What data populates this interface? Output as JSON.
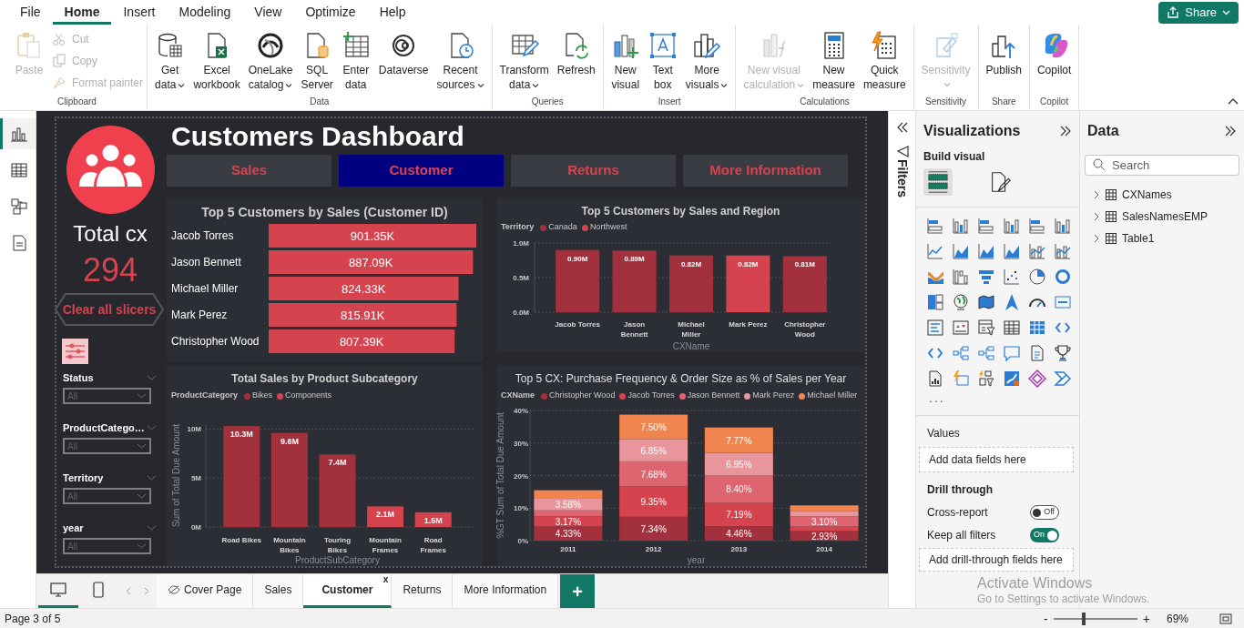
{
  "menu": [
    {
      "label": "File",
      "selected": false
    },
    {
      "label": "Home",
      "selected": true
    },
    {
      "label": "Insert",
      "selected": false
    },
    {
      "label": "Modeling",
      "selected": false
    },
    {
      "label": "View",
      "selected": false
    },
    {
      "label": "Optimize",
      "selected": false
    },
    {
      "label": "Help",
      "selected": false
    }
  ],
  "share_button": {
    "label": "Share"
  },
  "ribbon_groups": [
    {
      "label": "Clipboard",
      "commands": [
        {
          "kind": "large",
          "lines": [
            "Paste"
          ],
          "disabled": true,
          "dropdown": false
        },
        {
          "kind": "small",
          "lines": [
            "Cut"
          ],
          "disabled": true,
          "dropdown": false
        },
        {
          "kind": "small",
          "lines": [
            "Copy"
          ],
          "disabled": true,
          "dropdown": false
        },
        {
          "kind": "small",
          "lines": [
            "Format painter"
          ],
          "disabled": true,
          "dropdown": false
        }
      ]
    },
    {
      "label": "Data",
      "commands": [
        {
          "kind": "large",
          "lines": [
            "Get",
            "data"
          ],
          "disabled": false,
          "dropdown": true
        },
        {
          "kind": "large",
          "lines": [
            "Excel",
            "workbook"
          ],
          "disabled": false,
          "dropdown": false
        },
        {
          "kind": "large",
          "lines": [
            "OneLake",
            "catalog"
          ],
          "disabled": false,
          "dropdown": true
        },
        {
          "kind": "large",
          "lines": [
            "SQL",
            "Server"
          ],
          "disabled": false,
          "dropdown": false
        },
        {
          "kind": "large",
          "lines": [
            "Enter",
            "data"
          ],
          "disabled": false,
          "dropdown": false
        },
        {
          "kind": "large",
          "lines": [
            "Dataverse"
          ],
          "disabled": false,
          "dropdown": false
        },
        {
          "kind": "large",
          "lines": [
            "Recent",
            "sources"
          ],
          "disabled": false,
          "dropdown": true
        }
      ]
    },
    {
      "label": "Queries",
      "commands": [
        {
          "kind": "large",
          "lines": [
            "Transform",
            "data"
          ],
          "disabled": false,
          "dropdown": true
        },
        {
          "kind": "large",
          "lines": [
            "Refresh"
          ],
          "disabled": false,
          "dropdown": false
        }
      ]
    },
    {
      "label": "Insert",
      "commands": [
        {
          "kind": "large",
          "lines": [
            "New",
            "visual"
          ],
          "disabled": false,
          "dropdown": false
        },
        {
          "kind": "large",
          "lines": [
            "Text",
            "box"
          ],
          "disabled": false,
          "dropdown": false
        },
        {
          "kind": "large",
          "lines": [
            "More",
            "visuals"
          ],
          "disabled": false,
          "dropdown": true
        }
      ]
    },
    {
      "label": "Calculations",
      "commands": [
        {
          "kind": "large",
          "lines": [
            "New visual",
            "calculation"
          ],
          "disabled": true,
          "dropdown": true
        },
        {
          "kind": "large",
          "lines": [
            "New",
            "measure"
          ],
          "disabled": false,
          "dropdown": false
        },
        {
          "kind": "large",
          "lines": [
            "Quick",
            "measure"
          ],
          "disabled": false,
          "dropdown": false
        }
      ]
    },
    {
      "label": "Sensitivity",
      "commands": [
        {
          "kind": "large",
          "lines": [
            "Sensitivity"
          ],
          "disabled": true,
          "dropdown": true
        }
      ]
    },
    {
      "label": "Share",
      "commands": [
        {
          "kind": "large",
          "lines": [
            "Publish"
          ],
          "disabled": false,
          "dropdown": false
        }
      ]
    },
    {
      "label": "Copilot",
      "commands": [
        {
          "kind": "large",
          "lines": [
            "Copilot"
          ],
          "disabled": false,
          "dropdown": false
        }
      ]
    }
  ],
  "view_switcher": [
    {
      "selected": true
    },
    {
      "selected": false
    },
    {
      "selected": false
    },
    {
      "selected": false
    }
  ],
  "report": {
    "title": "Customers Dashboard",
    "kpi": {
      "label": "Total cx",
      "value": "294"
    },
    "clear_button": {
      "label": "Clear all slicers"
    },
    "nav_buttons": [
      {
        "label": "Sales",
        "selected": false
      },
      {
        "label": "Customer",
        "selected": true
      },
      {
        "label": "Returns",
        "selected": false
      },
      {
        "label": "More Information",
        "selected": false
      }
    ],
    "slicers": [
      {
        "label": "Status",
        "value": "All"
      },
      {
        "label": "ProductCatego…",
        "value": "All"
      },
      {
        "label": "Territory",
        "value": "All"
      },
      {
        "label": "year",
        "value": "All"
      }
    ],
    "charts": [
      {
        "title": "Top 5 Customers by Sales (Customer ID)",
        "chart_data": {
          "type": "bar",
          "orientation": "horizontal",
          "categories": [
            "Jacob Torres",
            "Jason Bennett",
            "Michael Miller",
            "Mark Perez",
            "Christopher Wood"
          ],
          "values": [
            901.35,
            887.09,
            824.33,
            815.91,
            807.39
          ],
          "value_labels": [
            "901.35K",
            "887.09K",
            "824.33K",
            "815.91K",
            "807.39K"
          ]
        }
      },
      {
        "title": "Top 5 Customers by Sales and Region",
        "legend_title": "Territory",
        "chart_data": {
          "type": "bar",
          "stacked": true,
          "grid": true,
          "xlabel": "CXName",
          "categories": [
            "Jacob Torres",
            "Jason Bennett",
            "Michael Miller",
            "Mark Perez",
            "Christopher Wood"
          ],
          "series": [
            {
              "name": "Canada",
              "color": "#a3313d",
              "values": [
                0.9,
                0.89,
                0.82,
                null,
                0.81
              ]
            },
            {
              "name": "Northwest",
              "color": "#d5434f",
              "values": [
                null,
                null,
                null,
                0.82,
                null
              ]
            }
          ],
          "ylim": [
            0,
            1
          ],
          "yticks": [
            {
              "value": 0,
              "label": "0.0M"
            },
            {
              "value": 0.5,
              "label": "0.5M"
            },
            {
              "value": 1,
              "label": "1.0M"
            }
          ],
          "value_labels": [
            [
              "0.90M",
              "0.89M",
              "0.82M",
              null,
              "0.81M"
            ],
            [
              null,
              null,
              null,
              "0.82M",
              null
            ]
          ]
        }
      },
      {
        "title": "Total Sales by Product Subcategory",
        "legend_title": "ProductCategory",
        "chart_data": {
          "type": "bar",
          "stacked": true,
          "grid": true,
          "xlabel": "ProductSubCategory",
          "ylabel": "Sum of Total Due Amount",
          "categories": [
            "Road Bikes",
            "Mountain Bikes",
            "Touring Bikes",
            "Mountain Frames",
            "Road Frames"
          ],
          "series": [
            {
              "name": "Bikes",
              "color": "#a3313d",
              "values": [
                10.3,
                9.6,
                7.4,
                null,
                null
              ]
            },
            {
              "name": "Components",
              "color": "#d5434f",
              "values": [
                null,
                null,
                null,
                2.1,
                1.5
              ]
            }
          ],
          "ylim": [
            0,
            10.5
          ],
          "yticks": [
            {
              "value": 0,
              "label": "0M"
            },
            {
              "value": 5,
              "label": "5M"
            },
            {
              "value": 10,
              "label": "10M"
            }
          ],
          "value_labels": [
            [
              "10.3M",
              "9.6M",
              "7.4M",
              null,
              null
            ],
            [
              null,
              null,
              null,
              "2.1M",
              "1.5M"
            ]
          ]
        }
      },
      {
        "title": "Top 5 CX: Purchase Frequency & Order Size as % of Sales per Year",
        "legend_title": "CXName",
        "chart_data": {
          "type": "bar",
          "stacked": true,
          "grid": true,
          "xlabel": "year",
          "ylabel": "%GT Sum of Total Due Amount",
          "categories": [
            "2011",
            "2012",
            "2013",
            "2014"
          ],
          "series": [
            {
              "name": "Christopher Wood",
              "color": "#a3313d",
              "values": [
                4.33,
                7.34,
                4.46,
                2.93
              ]
            },
            {
              "name": "Jacob Torres",
              "color": "#d5434f",
              "values": [
                3.17,
                9.35,
                7.19,
                1.4
              ]
            },
            {
              "name": "Jason Bennett",
              "color": "#de6570",
              "values": [
                1.8,
                7.68,
                8.4,
                3.1
              ]
            },
            {
              "name": "Mark Perez",
              "color": "#e8959b",
              "values": [
                3.58,
                6.85,
                6.95,
                1.7
              ]
            },
            {
              "name": "Michael Miller",
              "color": "#f0854f",
              "values": [
                2.6,
                7.5,
                7.77,
                1.7
              ]
            }
          ],
          "ylim": [
            0,
            40
          ],
          "yticks": [
            {
              "value": 0,
              "label": "0%"
            },
            {
              "value": 10,
              "label": "10%"
            },
            {
              "value": 20,
              "label": "20%"
            },
            {
              "value": 30,
              "label": "30%"
            },
            {
              "value": 40,
              "label": "40%"
            }
          ],
          "value_labels": [
            [
              "4.33%",
              "7.34%",
              "4.46%",
              "2.93%"
            ],
            [
              "3.17%",
              "9.35%",
              "7.19%",
              null
            ],
            [
              null,
              "7.68%",
              "8.40%",
              "3.10%"
            ],
            [
              "3.58%",
              "6.85%",
              "6.95%",
              null
            ],
            [
              null,
              "7.50%",
              "7.77%",
              null
            ]
          ]
        }
      }
    ]
  },
  "filters_pane": {
    "label": "Filters"
  },
  "visualizations_pane": {
    "title": "Visualizations",
    "section": "Build visual",
    "modes": [
      {
        "selected": true
      },
      {
        "selected": false
      }
    ],
    "more_button": "...",
    "values_label": "Values",
    "values_field": {
      "placeholder": "Add data fields here"
    },
    "drill_label": "Drill through",
    "toggles": [
      {
        "label": "Cross-report",
        "on": false,
        "state_text": "Off"
      },
      {
        "label": "Keep all filters",
        "on": true,
        "state_text": "On"
      }
    ],
    "drill_field": {
      "placeholder": "Add drill-through fields here"
    }
  },
  "data_pane": {
    "title": "Data",
    "search": {
      "placeholder": "Search"
    },
    "tables": [
      {
        "label": "CXNames",
        "expanded": false
      },
      {
        "label": "SalesNamesEMP",
        "expanded": false
      },
      {
        "label": "Table1",
        "expanded": false
      }
    ]
  },
  "page_tabs": {
    "layouts": [
      {
        "selected": true
      },
      {
        "selected": false
      }
    ],
    "pages": [
      {
        "label": "Cover Page",
        "selected": false,
        "hidden": true
      },
      {
        "label": "Sales",
        "selected": false,
        "hidden": false
      },
      {
        "label": "Customer",
        "selected": true,
        "hidden": false
      },
      {
        "label": "Returns",
        "selected": false,
        "hidden": false
      },
      {
        "label": "More Information",
        "selected": false,
        "hidden": false
      }
    ],
    "close_glyph": "x",
    "add_glyph": "+"
  },
  "status_bar": {
    "page": "Page 3 of 5",
    "zoom": {
      "minus": "-",
      "plus": "+",
      "level": 0.36,
      "reading": "69%"
    }
  },
  "os_notice": {
    "title": "Activate Windows",
    "text": "Go to Settings to activate Windows."
  }
}
